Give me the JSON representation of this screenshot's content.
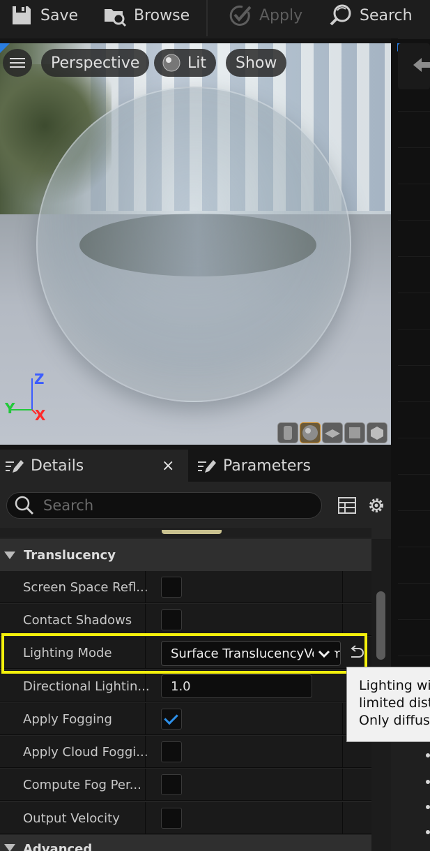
{
  "toolbar": {
    "save_label": "Save",
    "browse_label": "Browse",
    "apply_label": "Apply",
    "search_label": "Search"
  },
  "viewport": {
    "perspective_label": "Perspective",
    "lit_label": "Lit",
    "show_label": "Show",
    "axis_z": "Z",
    "axis_y": "Y",
    "axis_x": "X",
    "preview_shapes": [
      "cylinder",
      "sphere",
      "plane",
      "cube",
      "custom mesh"
    ]
  },
  "tabs": {
    "details_label": "Details",
    "details_close": "×",
    "parameters_label": "Parameters"
  },
  "details": {
    "search_placeholder": "Search",
    "category": "Translucency",
    "properties": [
      {
        "name": "Screen Space Refl...",
        "type": "checkbox",
        "checked": false
      },
      {
        "name": "Contact Shadows",
        "type": "checkbox",
        "checked": false
      },
      {
        "name": "Lighting Mode",
        "type": "dropdown",
        "value": "Surface TranslucencyVolume"
      },
      {
        "name": "Directional Lightin...",
        "type": "number",
        "value": "1.0"
      },
      {
        "name": "Apply Fogging",
        "type": "checkbox",
        "checked": true
      },
      {
        "name": "Apply Cloud Foggi...",
        "type": "checkbox",
        "checked": false
      },
      {
        "name": "Compute Fog Per...",
        "type": "checkbox",
        "checked": false
      },
      {
        "name": "Output Velocity",
        "type": "checkbox",
        "checked": false
      }
    ],
    "next_category": "Advanced"
  },
  "tooltip": {
    "line1": "Lighting wi",
    "line2": "limited dist",
    "line3": "Only diffus"
  },
  "colors": {
    "highlight": "#f4f00c",
    "checkbox_check": "#2d8fe8",
    "axis_z": "#3b5cff",
    "axis_y": "#22c93a",
    "axis_x": "#ff2a2a"
  }
}
